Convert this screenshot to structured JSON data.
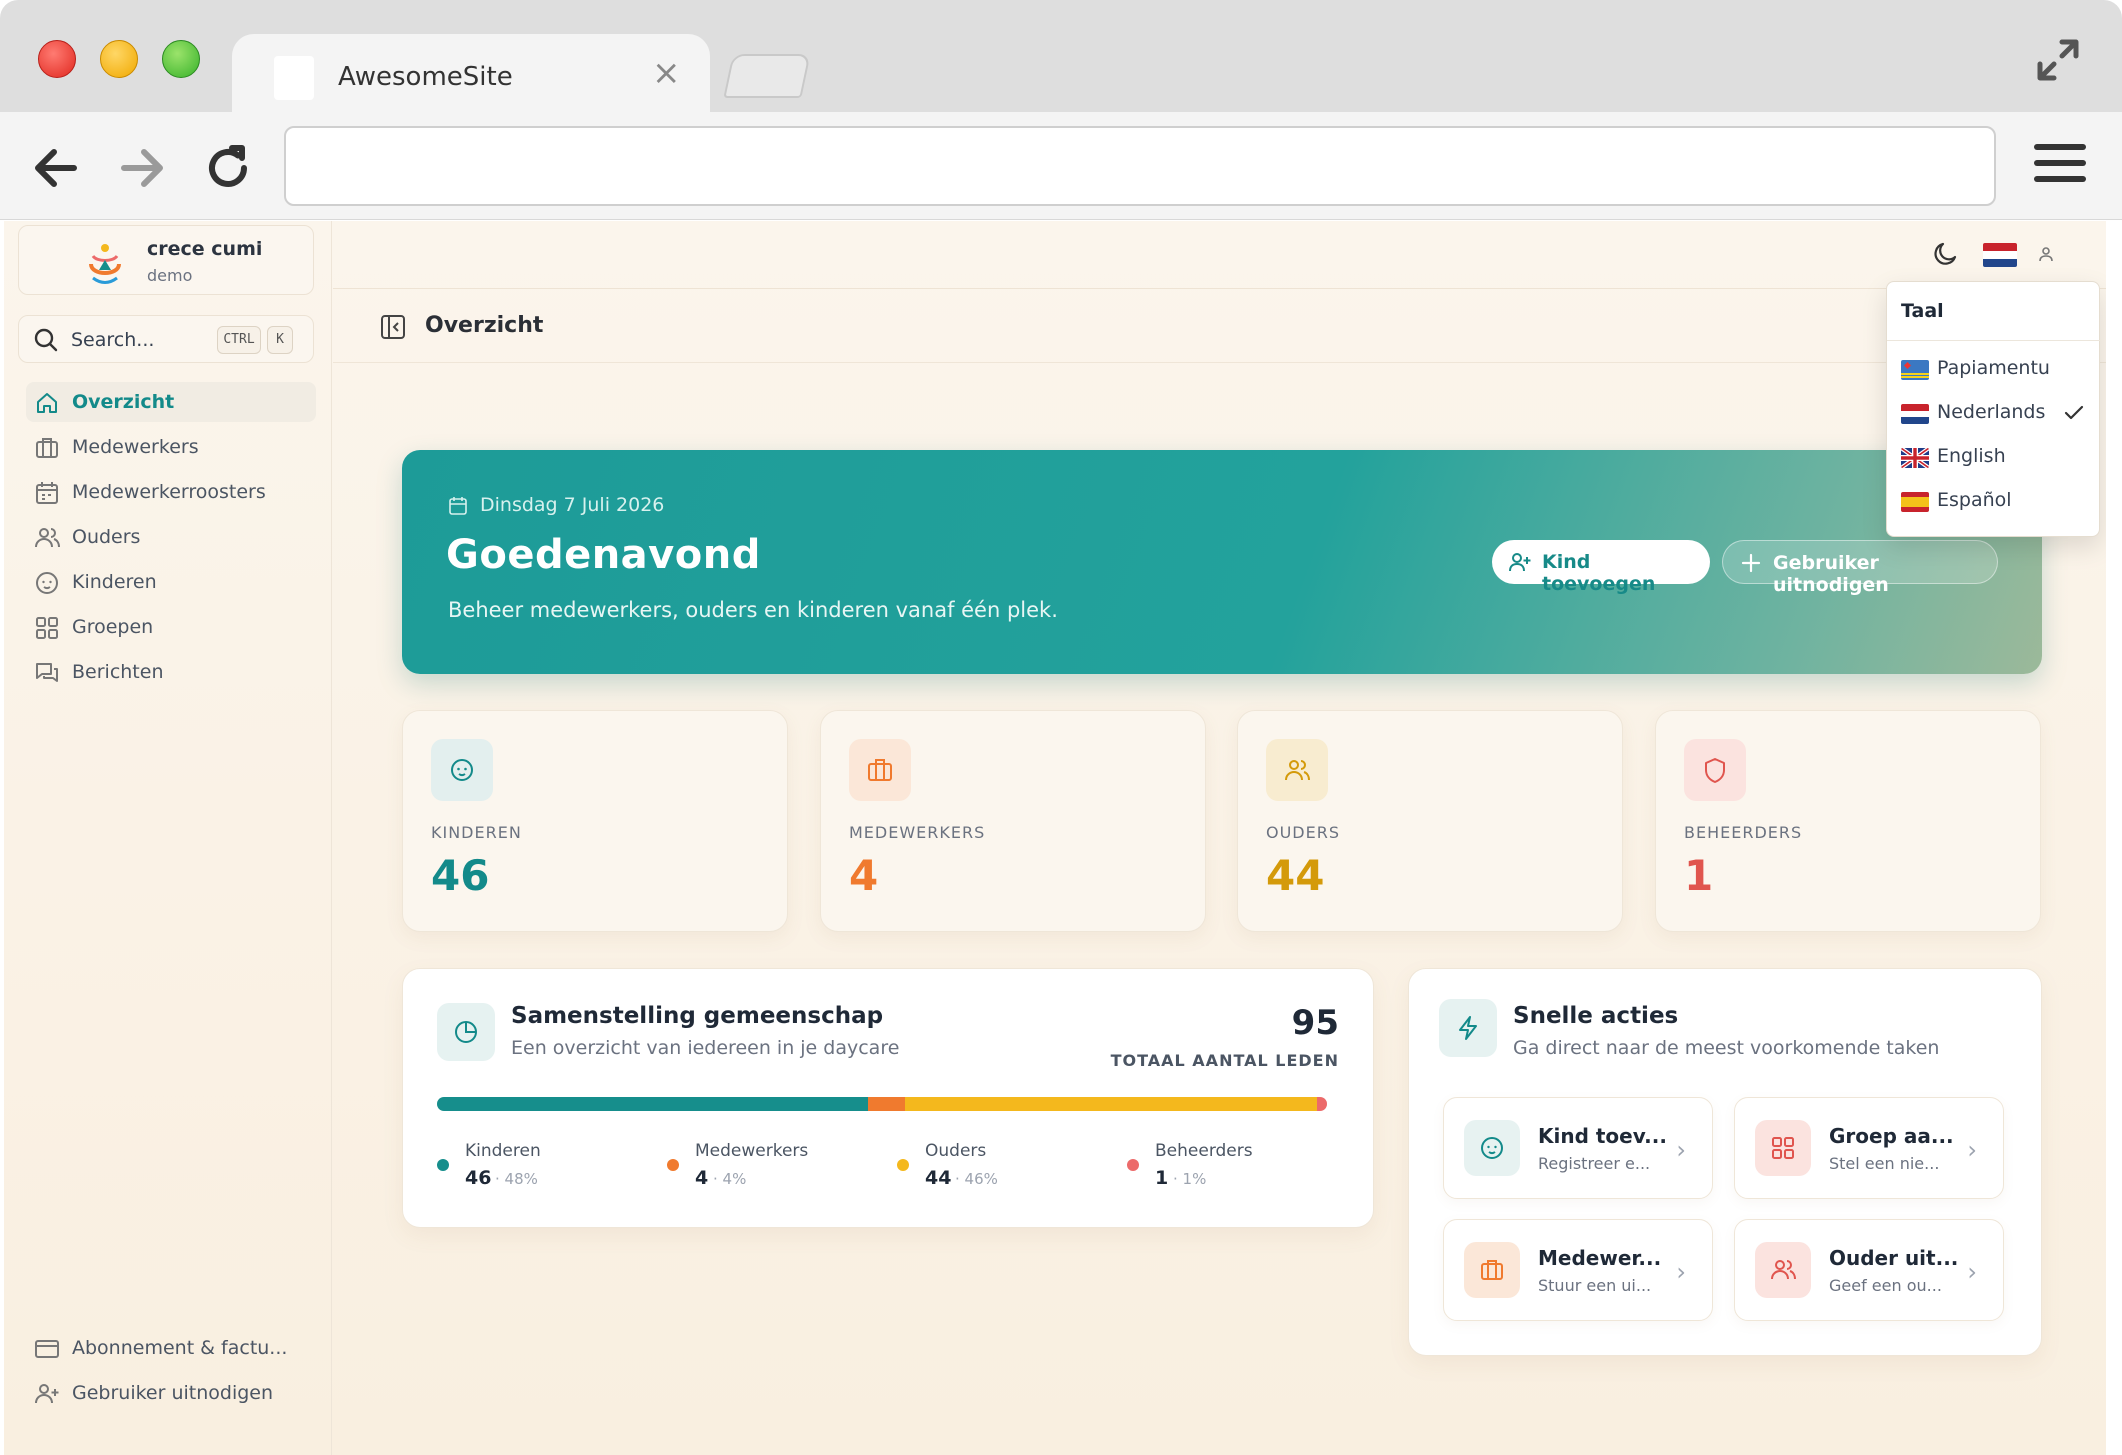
{
  "browser": {
    "tab_title": "AwesomeSite",
    "address": ""
  },
  "app": {
    "brand_name": "crece cumi",
    "brand_sub": "demo",
    "search_placeholder": "Search...",
    "search_kbd": [
      "CTRL",
      "K"
    ],
    "nav": [
      {
        "label": "Overzicht",
        "icon": "home-icon",
        "active": true
      },
      {
        "label": "Medewerkers",
        "icon": "briefcase-icon"
      },
      {
        "label": "Medewerkerroosters",
        "icon": "calendar-icon"
      },
      {
        "label": "Ouders",
        "icon": "users-icon"
      },
      {
        "label": "Kinderen",
        "icon": "baby-icon"
      },
      {
        "label": "Groepen",
        "icon": "grid-icon"
      },
      {
        "label": "Berichten",
        "icon": "messages-icon"
      }
    ],
    "bottom_nav": [
      {
        "label": "Abonnement & factu...",
        "icon": "credit-card-icon"
      },
      {
        "label": "Gebruiker uitnodigen",
        "icon": "user-plus-icon"
      }
    ],
    "page_title": "Overzicht"
  },
  "hero": {
    "date": "Dinsdag 7 Juli 2026",
    "greeting": "Goedenavond",
    "subtitle": "Beheer medewerkers, ouders en kinderen vanaf één plek.",
    "btn_add_child": "Kind toevoegen",
    "btn_invite": "Gebruiker uitnodigen"
  },
  "stats": [
    {
      "label": "KINDEREN",
      "value": "46",
      "color": "#138a8a",
      "icon": "baby-icon",
      "bg": "#e3efee"
    },
    {
      "label": "MEDEWERKERS",
      "value": "4",
      "color": "#f07a2e",
      "icon": "briefcase-icon",
      "bg": "#fbe7d8"
    },
    {
      "label": "OUDERS",
      "value": "44",
      "color": "#d49a0a",
      "icon": "users-icon",
      "bg": "#f8ecd0"
    },
    {
      "label": "BEHEERDERS",
      "value": "1",
      "color": "#e0554e",
      "icon": "shield-icon",
      "bg": "#fbe3df"
    }
  ],
  "composition": {
    "title": "Samenstelling gemeenschap",
    "subtitle": "Een overzicht van iedereen in je daycare",
    "total": "95",
    "total_label": "TOTAAL AANTAL LEDEN",
    "segments": [
      {
        "name": "Kinderen",
        "value": "46",
        "pct": "· 48%",
        "fraction": 48.4,
        "color": "#168e8c"
      },
      {
        "name": "Medewerkers",
        "value": "4",
        "pct": "· 4%",
        "fraction": 4.2,
        "color": "#f07a2e"
      },
      {
        "name": "Ouders",
        "value": "44",
        "pct": "· 46%",
        "fraction": 46.3,
        "color": "#f4b81d"
      },
      {
        "name": "Beheerders",
        "value": "1",
        "pct": "· 1%",
        "fraction": 1.1,
        "color": "#ec6a6a"
      }
    ]
  },
  "quick_actions": {
    "title": "Snelle acties",
    "subtitle": "Ga direct naar de meest voorkomende taken",
    "items": [
      {
        "title": "Kind toev...",
        "sub": "Registreer e...",
        "icon": "baby-icon"
      },
      {
        "title": "Groep aa...",
        "sub": "Stel een nie...",
        "icon": "grid-icon"
      },
      {
        "title": "Medewer...",
        "sub": "Stuur een ui...",
        "icon": "briefcase-icon"
      },
      {
        "title": "Ouder uit...",
        "sub": "Geef een ou...",
        "icon": "users-icon"
      }
    ]
  },
  "language_menu": {
    "heading": "Taal",
    "items": [
      {
        "label": "Papiamentu",
        "flag": "aruba"
      },
      {
        "label": "Nederlands",
        "flag": "nl",
        "selected": true
      },
      {
        "label": "English",
        "flag": "uk"
      },
      {
        "label": "Español",
        "flag": "es"
      }
    ]
  }
}
